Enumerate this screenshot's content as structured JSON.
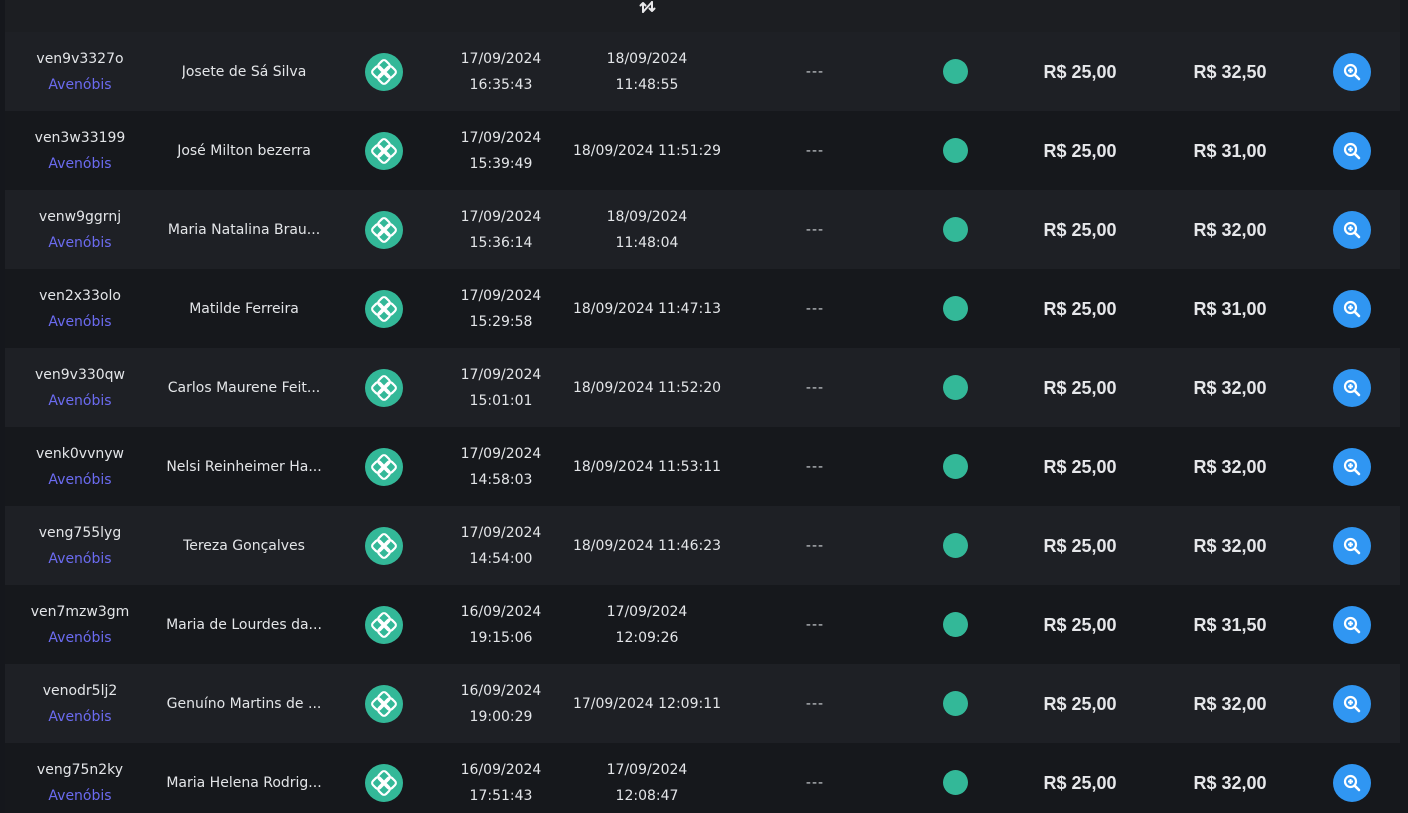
{
  "colors": {
    "accent_green": "#33b898",
    "action_blue": "#3096f2",
    "store_link": "#6b6bf0",
    "row_dark": "#16181c",
    "row_light": "#1e2025"
  },
  "header": {
    "sort_icon": "sort-arrows-icon"
  },
  "rows": [
    {
      "code": "ven9v3327o",
      "store": "Avenóbis",
      "name": "Josete de Sá Silva",
      "created_date": "17/09/2024",
      "created_time": "16:35:43",
      "updated_date": "18/09/2024",
      "updated_time": "11:48:55",
      "extra": "---",
      "value1": "R$ 25,00",
      "value2": "R$ 32,50"
    },
    {
      "code": "ven3w33199",
      "store": "Avenóbis",
      "name": "José Milton bezerra",
      "created_date": "17/09/2024",
      "created_time": "15:39:49",
      "updated_date": "18/09/2024 11:51:29",
      "updated_time": "",
      "extra": "---",
      "value1": "R$ 25,00",
      "value2": "R$ 31,00"
    },
    {
      "code": "venw9ggrnj",
      "store": "Avenóbis",
      "name": "Maria Natalina Brau...",
      "created_date": "17/09/2024",
      "created_time": "15:36:14",
      "updated_date": "18/09/2024",
      "updated_time": "11:48:04",
      "extra": "---",
      "value1": "R$ 25,00",
      "value2": "R$ 32,00"
    },
    {
      "code": "ven2x33olo",
      "store": "Avenóbis",
      "name": "Matilde Ferreira",
      "created_date": "17/09/2024",
      "created_time": "15:29:58",
      "updated_date": "18/09/2024 11:47:13",
      "updated_time": "",
      "extra": "---",
      "value1": "R$ 25,00",
      "value2": "R$ 31,00"
    },
    {
      "code": "ven9v330qw",
      "store": "Avenóbis",
      "name": "Carlos Maurene Feit...",
      "created_date": "17/09/2024",
      "created_time": "15:01:01",
      "updated_date": "18/09/2024 11:52:20",
      "updated_time": "",
      "extra": "---",
      "value1": "R$ 25,00",
      "value2": "R$ 32,00"
    },
    {
      "code": "venk0vvnyw",
      "store": "Avenóbis",
      "name": "Nelsi Reinheimer Ha...",
      "created_date": "17/09/2024",
      "created_time": "14:58:03",
      "updated_date": "18/09/2024 11:53:11",
      "updated_time": "",
      "extra": "---",
      "value1": "R$ 25,00",
      "value2": "R$ 32,00"
    },
    {
      "code": "veng755lyg",
      "store": "Avenóbis",
      "name": "Tereza Gonçalves",
      "created_date": "17/09/2024",
      "created_time": "14:54:00",
      "updated_date": "18/09/2024 11:46:23",
      "updated_time": "",
      "extra": "---",
      "value1": "R$ 25,00",
      "value2": "R$ 32,00"
    },
    {
      "code": "ven7mzw3gm",
      "store": "Avenóbis",
      "name": "Maria de Lourdes da...",
      "created_date": "16/09/2024",
      "created_time": "19:15:06",
      "updated_date": "17/09/2024",
      "updated_time": "12:09:26",
      "extra": "---",
      "value1": "R$ 25,00",
      "value2": "R$ 31,50"
    },
    {
      "code": "venodr5lj2",
      "store": "Avenóbis",
      "name": "Genuíno Martins de ...",
      "created_date": "16/09/2024",
      "created_time": "19:00:29",
      "updated_date": "17/09/2024 12:09:11",
      "updated_time": "",
      "extra": "---",
      "value1": "R$ 25,00",
      "value2": "R$ 32,00"
    },
    {
      "code": "veng75n2ky",
      "store": "Avenóbis",
      "name": "Maria Helena Rodrig...",
      "created_date": "16/09/2024",
      "created_time": "17:51:43",
      "updated_date": "17/09/2024",
      "updated_time": "12:08:47",
      "extra": "---",
      "value1": "R$ 25,00",
      "value2": "R$ 32,00"
    }
  ]
}
